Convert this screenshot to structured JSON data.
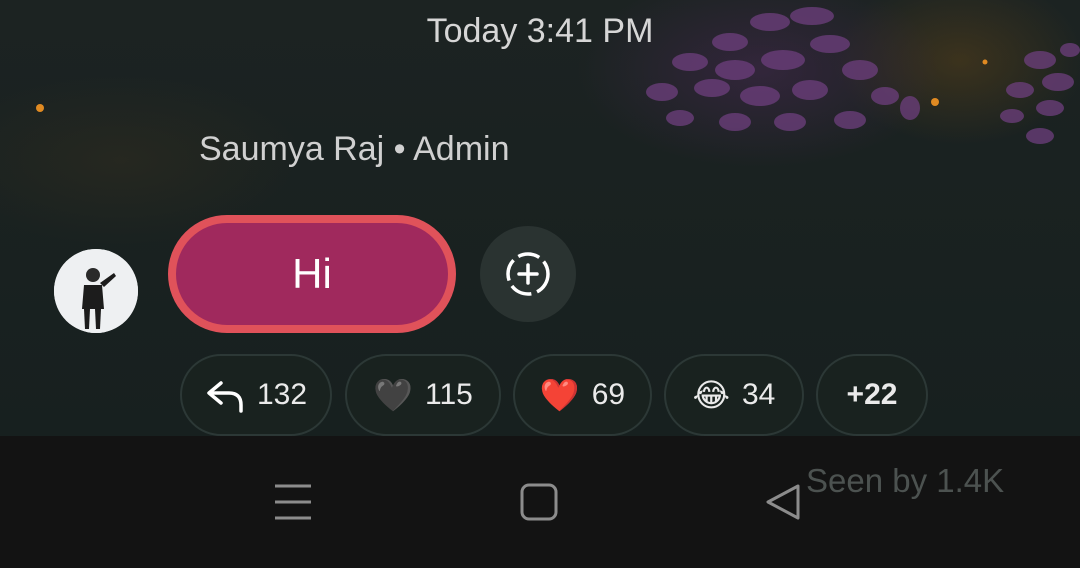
{
  "timestamp": "Today 3:41 PM",
  "message": {
    "sender": "Saumya Raj • Admin",
    "text": "Hi",
    "bubble_color": "#a0295d",
    "bubble_border_color": "#e0525a"
  },
  "reactions": [
    {
      "icon": "reply-icon",
      "count": "132"
    },
    {
      "icon": "black-heart-icon",
      "emoji": "🖤",
      "count": "115"
    },
    {
      "icon": "red-heart-icon",
      "emoji": "❤️",
      "count": "69"
    },
    {
      "icon": "tears-of-joy-icon",
      "emoji": "😂",
      "count": "34"
    },
    {
      "label": "+22"
    }
  ],
  "seen_by": "Seen by 1.4K",
  "navbar": {
    "icons": [
      "menu-icon",
      "home-icon",
      "back-icon"
    ]
  }
}
